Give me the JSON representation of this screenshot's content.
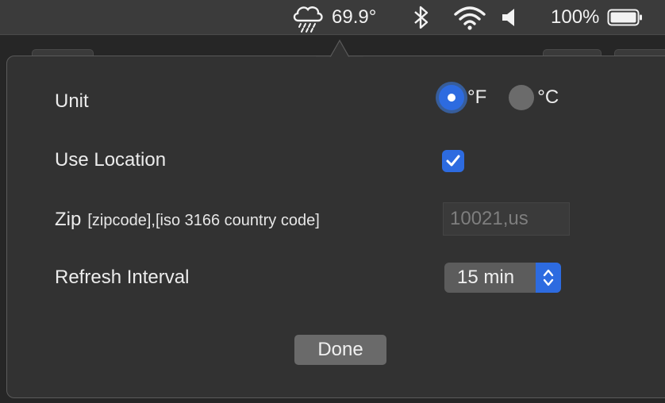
{
  "menubar": {
    "weather_icon": "cloud-rain-icon",
    "temperature": "69.9°",
    "bluetooth_icon": "bluetooth-icon",
    "wifi_icon": "wifi-icon",
    "volume_icon": "speaker-icon",
    "battery_percent": "100%",
    "battery_icon": "battery-icon"
  },
  "popover": {
    "unit": {
      "label": "Unit",
      "options": [
        {
          "label": "°F",
          "selected": true
        },
        {
          "label": "°C",
          "selected": false
        }
      ]
    },
    "use_location": {
      "label": "Use Location",
      "checked": true
    },
    "zip": {
      "label": "Zip",
      "hint": "[zipcode],[iso 3166 country code]",
      "placeholder": "10021,us"
    },
    "refresh": {
      "label": "Refresh Interval",
      "value": "15 min"
    },
    "done_label": "Done"
  },
  "colors": {
    "accent": "#2d6be0",
    "panel": "#323232",
    "menubar": "#3b3b3b"
  }
}
